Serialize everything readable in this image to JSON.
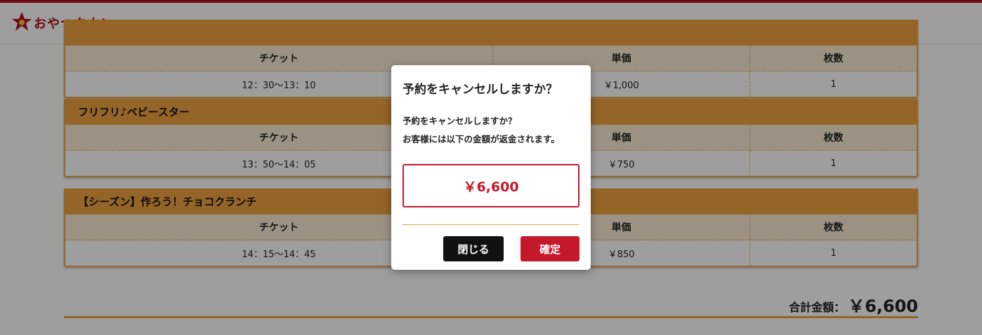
{
  "brand": {
    "name": "おやつタウン",
    "logo_icon": "star-icon",
    "accent": "#b3111f"
  },
  "sections": [
    {
      "title": "",
      "headers": [
        "チケット",
        "単価",
        "枚数"
      ],
      "row": {
        "time": "12：30～13：10",
        "price": "￥1,000",
        "qty": "1"
      }
    },
    {
      "title": "フリフリ♪ベビースター",
      "headers": [
        "チケット",
        "単価",
        "枚数"
      ],
      "row": {
        "time": "13：50～14：05",
        "price": "￥750",
        "qty": "1"
      }
    },
    {
      "title": "【シーズン】作ろう！チョコクランチ",
      "headers": [
        "チケット",
        "単価",
        "枚数"
      ],
      "row": {
        "time": "14：15～14：45",
        "price": "￥850",
        "qty": "1"
      }
    }
  ],
  "total": {
    "label": "合計金額：",
    "value": "￥6,600"
  },
  "modal": {
    "title": "予約をキャンセルしますか？",
    "message_line1": "予約をキャンセルしますか？",
    "message_line2": "お客様には以下の金額が返金されます。",
    "refund_amount": "￥6,600",
    "close_label": "閉じる",
    "confirm_label": "確定"
  },
  "colors": {
    "section_header": "#f0a340",
    "confirm": "#c4182b",
    "close": "#111111"
  }
}
